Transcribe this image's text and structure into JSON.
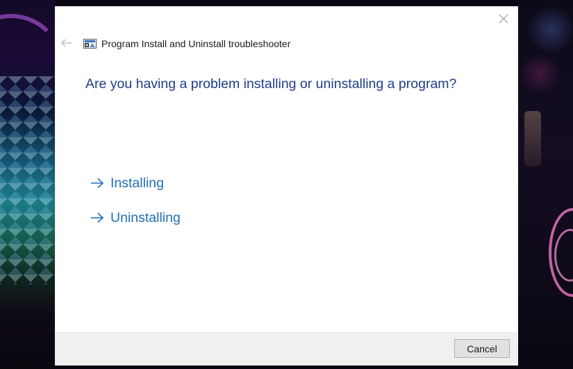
{
  "window": {
    "title": "Program Install and Uninstall troubleshooter",
    "close_icon": "close-icon",
    "back_icon": "back-arrow-icon",
    "app_icon": "troubleshooter-app-icon"
  },
  "main": {
    "heading": "Are you having a problem installing or uninstalling a program?",
    "options": [
      {
        "label": "Installing",
        "icon": "arrow-right-icon"
      },
      {
        "label": "Uninstalling",
        "icon": "arrow-right-icon"
      }
    ]
  },
  "footer": {
    "cancel_label": "Cancel"
  },
  "colors": {
    "heading": "#1f3d8a",
    "link": "#1f6fb8",
    "footer_bg": "#f0f0f0"
  }
}
